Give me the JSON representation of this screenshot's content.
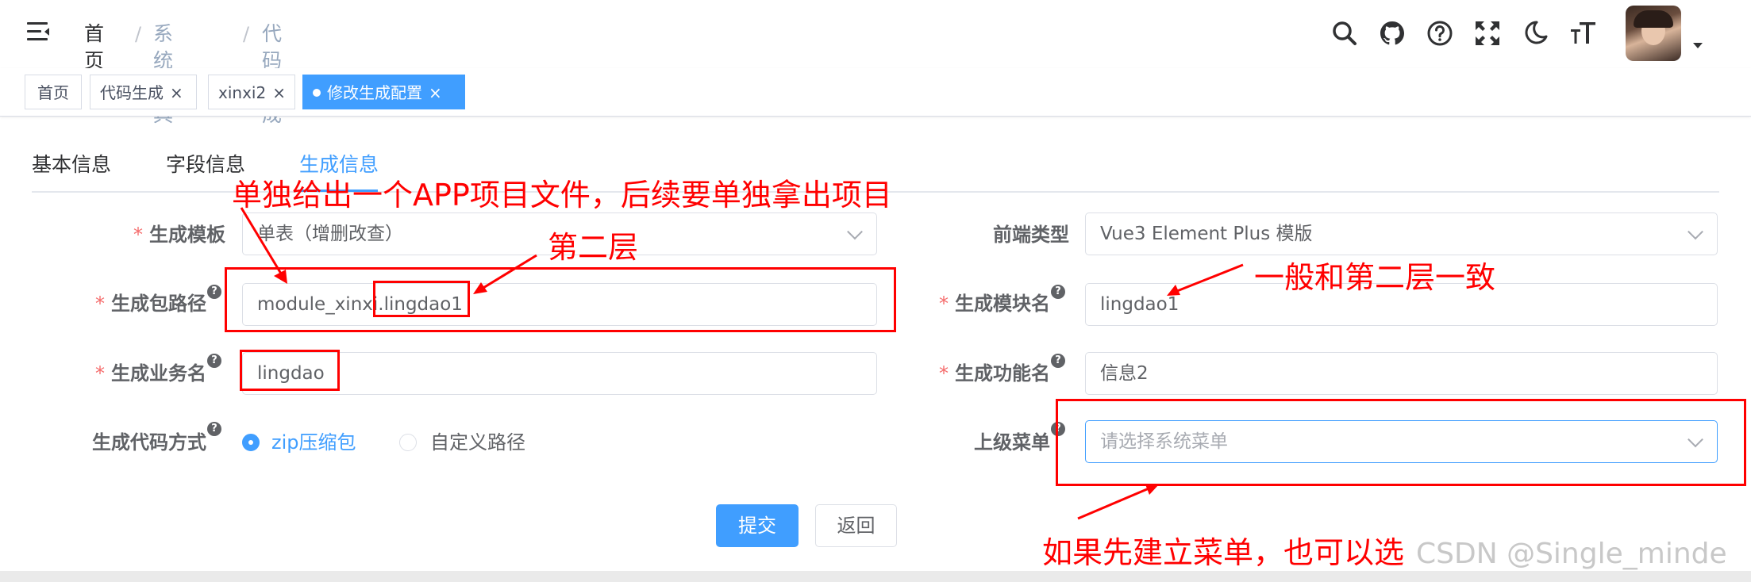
{
  "header": {
    "breadcrumb": [
      "首页",
      "系统工具",
      "代码生成"
    ],
    "breadcrumb_separator": "/",
    "icons": [
      "search-icon",
      "github-icon",
      "help-icon",
      "fullscreen-icon",
      "dark-mode-icon",
      "font-size-icon"
    ]
  },
  "tags": [
    {
      "label": "首页",
      "closable": false,
      "active": false
    },
    {
      "label": "代码生成",
      "closable": true,
      "active": false
    },
    {
      "label": "xinxi2",
      "closable": true,
      "active": false
    },
    {
      "label": "修改生成配置",
      "closable": true,
      "active": true
    }
  ],
  "tag_close": "×",
  "tabs": [
    "基本信息",
    "字段信息",
    "生成信息"
  ],
  "form": {
    "required_mark": "*",
    "help_mark": "?",
    "tpl_label": "生成模板",
    "tpl_value": "单表（增删改查）",
    "frontend_label": "前端类型",
    "frontend_value": "Vue3 Element Plus 模版",
    "package_label": "生成包路径",
    "package_value": "module_xinxi.lingdao1",
    "module_label": "生成模块名",
    "module_value": "lingdao1",
    "business_label": "生成业务名",
    "business_value": "lingdao",
    "function_label": "生成功能名",
    "function_value": "信息2",
    "gentype_label": "生成代码方式",
    "gentype_options": [
      "zip压缩包",
      "自定义路径"
    ],
    "gentype_selected": 0,
    "parent_menu_label": "上级菜单",
    "parent_menu_placeholder": "请选择系统菜单",
    "submit_label": "提交",
    "back_label": "返回"
  },
  "annotations": {
    "top_note": "单独给出一个APP项目文件，后续要单独拿出项目",
    "second_layer": "第二层",
    "same_as_second": "一般和第二层一致",
    "menu_note": "如果先建立菜单，也可以选"
  },
  "watermark": "CSDN @Single_minde",
  "colors": {
    "primary": "#409eff",
    "annotation": "#ff0000",
    "required": "#f56c6c"
  }
}
